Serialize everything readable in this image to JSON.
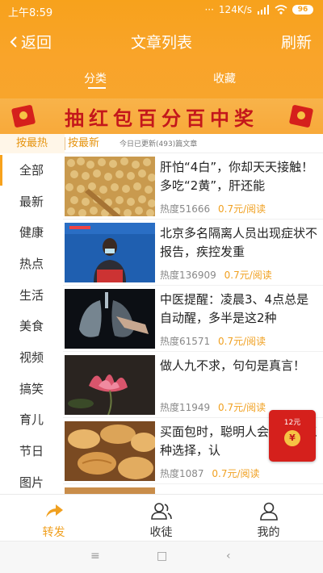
{
  "status_bar": {
    "time": "上午8:59",
    "dots": "···",
    "network_speed": "124K/s",
    "battery": "96"
  },
  "header": {
    "back_label": "返回",
    "title": "文章列表",
    "refresh_label": "刷新"
  },
  "tabs": [
    {
      "label": "分类",
      "active": true
    },
    {
      "label": "收藏",
      "active": false
    }
  ],
  "banner": {
    "text": "抽红包百分百中奖"
  },
  "sort_bar": {
    "hot_label": "按最热",
    "new_label": "按最新",
    "updated_text": "今日已更新(493)篇文章"
  },
  "categories": [
    {
      "label": "全部",
      "active": true
    },
    {
      "label": "最新"
    },
    {
      "label": "健康"
    },
    {
      "label": "热点"
    },
    {
      "label": "生活"
    },
    {
      "label": "美食"
    },
    {
      "label": "视频"
    },
    {
      "label": "搞笑"
    },
    {
      "label": "育儿"
    },
    {
      "label": "节日"
    },
    {
      "label": "图片"
    }
  ],
  "articles": [
    {
      "title": "肝怕“4白”，你却天天接触！多吃“2黄”，肝还能",
      "heat_label": "热度51666",
      "price": "0.7元/阅读",
      "thumb": "soybeans-photo"
    },
    {
      "title": "北京多名隔离人员出现症状不报告，疾控发重",
      "heat_label": "热度136909",
      "price": "0.7元/阅读",
      "thumb": "press-conference-photo"
    },
    {
      "title": "中医提醒：凌晨3、4点总是自动醒，多半是这2种",
      "heat_label": "热度61571",
      "price": "0.7元/阅读",
      "thumb": "lungs-photo"
    },
    {
      "title": "做人九不求，句句是真言！",
      "heat_label": "热度11949",
      "price": "0.7元/阅读",
      "thumb": "lotus-photo"
    },
    {
      "title": "买面包时，聪明人会避开这三种选择，认",
      "heat_label": "热度1087",
      "price": "0.7元/阅读",
      "thumb": "bread-photo"
    }
  ],
  "red_packet": {
    "amount": "12元",
    "coin_symbol": "¥"
  },
  "bottom_nav": [
    {
      "label": "转发",
      "icon": "share-icon",
      "active": true
    },
    {
      "label": "收徒",
      "icon": "apprentice-icon",
      "active": false
    },
    {
      "label": "我的",
      "icon": "profile-icon",
      "active": false
    }
  ],
  "system_nav": {
    "menu": "≡",
    "home": "□",
    "back": "‹"
  },
  "colors": {
    "brand_orange": "#f7a21c",
    "banner_red": "#c4171b",
    "price_orange": "#f0a020"
  }
}
